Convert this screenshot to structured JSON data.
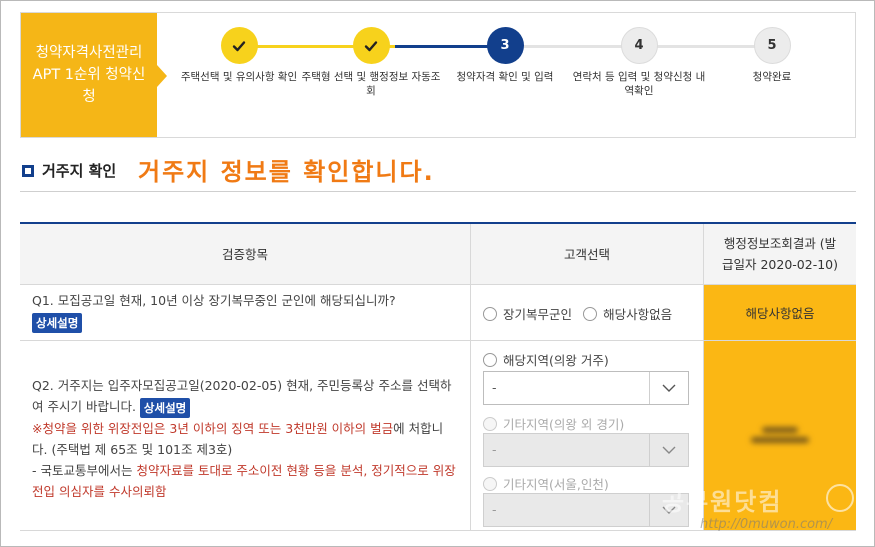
{
  "process": {
    "title": "청약자격사전관리 APT 1순위 청약신청",
    "steps": [
      {
        "number": "1",
        "label": "주택선택 및 유의사항 확인",
        "state": "done"
      },
      {
        "number": "2",
        "label": "주택형 선택 및 행정정보 자동조회",
        "state": "done"
      },
      {
        "number": "3",
        "label": "청약자격 확인 및 입력",
        "state": "current"
      },
      {
        "number": "4",
        "label": "연락처 등 입력 및 청약신청 내역확인",
        "state": "todo"
      },
      {
        "number": "5",
        "label": "청약완료",
        "state": "todo"
      }
    ]
  },
  "section": {
    "title": "거주지 확인",
    "annotation": "거주지 정보를 확인합니다."
  },
  "table": {
    "headers": {
      "item": "검증항목",
      "choice": "고객선택",
      "result": "행정정보조회결과 (발급일자 2020-02-10)"
    },
    "q1": {
      "text": "Q1. 모집공고일 현재, 10년 이상 장기복무중인 군인에 해당되십니까?",
      "detail_button": "상세설명",
      "option_a": "장기복무군인",
      "option_b": "해당사항없음",
      "result": "해당사항없음"
    },
    "q2": {
      "text": "Q2. 거주지는 입주자모집공고일(2020-02-05) 현재, 주민등록상 주소를 선택하여 주시기 바랍니다.",
      "detail_button": "상세설명",
      "warning1": "※청약을 위한 위장전입은 3년 이하의 징역 또는 3천만원 이하의 벌금",
      "warning1_tail": "에 처합니다. (주택법 제 65조 및 101조 제3호)",
      "warning2_head": "- 국토교통부에서는 ",
      "warning2": "청약자료를 토대로 주소이전 현황 등을 분석, 정기적으로 위장전입 의심자를 수사의뢰함",
      "region1_label": "해당지역(의왕 거주)",
      "region1_value": "-",
      "region2_label": "기타지역(의왕 외 경기)",
      "region2_value": "-",
      "region3_label": "기타지역(서울,인천)",
      "region3_value": "-"
    }
  },
  "watermark": {
    "text": "공무원닷컴",
    "url": "http://0muwon.com/"
  },
  "colors": {
    "accent_yellow": "#f5b617",
    "navy": "#123f8c",
    "result_bg": "#fbb714",
    "annotation": "#f07a14",
    "warning": "#c0392b"
  }
}
